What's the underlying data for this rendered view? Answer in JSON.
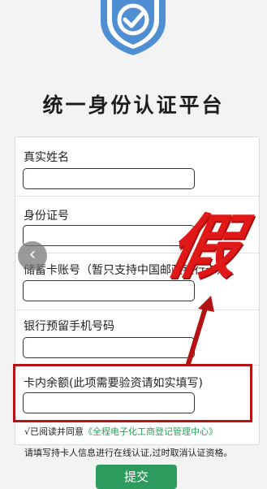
{
  "page": {
    "title": "统一身份认证平台",
    "accent_color": "#2d9a5e",
    "warning_color": "#b41313"
  },
  "form": {
    "fields": [
      {
        "label": "真实姓名",
        "value": ""
      },
      {
        "label": "身份证号",
        "value": ""
      },
      {
        "label": "储蓄卡账号（暂只支持中国邮政银行卡）",
        "value": ""
      },
      {
        "label": "银行预留手机号码",
        "value": ""
      },
      {
        "label": "卡内余额(此项需要验资请如实填写)",
        "value": ""
      }
    ],
    "agreement_prefix": "√已阅读并同意",
    "agreement_link": "《全程电子化工商登记管理中心》",
    "notice": "请填写持卡人信息进行在线认证,过时取消认证资格。",
    "submit_label": "提交"
  },
  "annotation": {
    "stamp_text": "假",
    "icon": "arrow-up-icon"
  },
  "nav": {
    "back_icon": "chevron-left-icon",
    "back_glyph": "‹"
  }
}
